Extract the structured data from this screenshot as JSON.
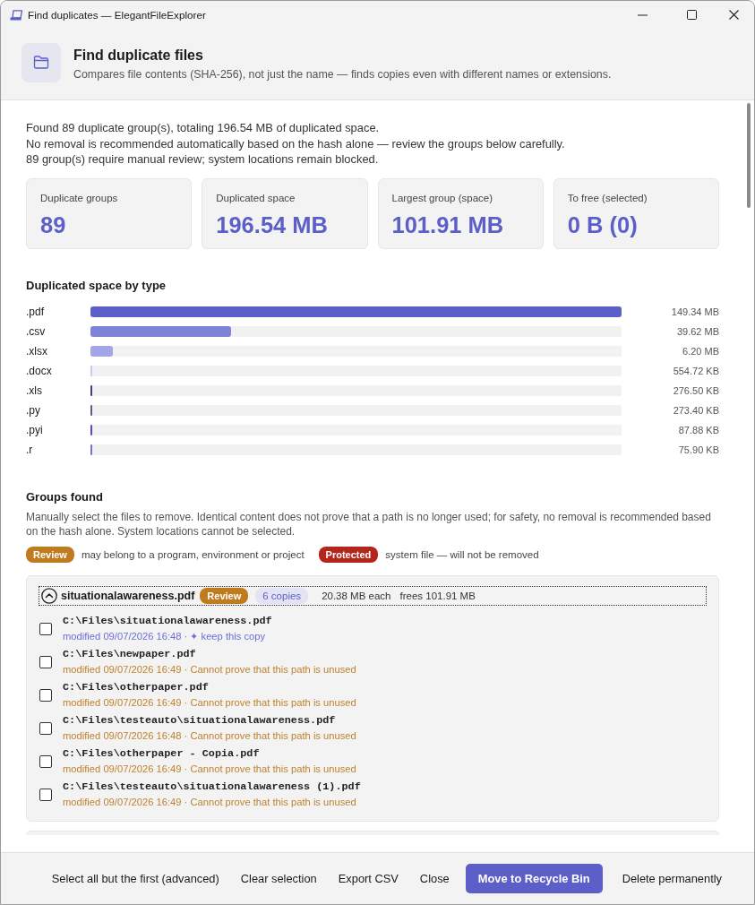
{
  "window": {
    "title": "Find duplicates — ElegantFileExplorer"
  },
  "header": {
    "title": "Find duplicate files",
    "subtitle": "Compares file contents (SHA-256), not just the name — finds copies even with different names or extensions."
  },
  "summary": [
    "Found 89 duplicate group(s), totaling 196.54 MB of duplicated space.",
    "No removal is recommended automatically based on the hash alone — review the groups below carefully.",
    "89 group(s) require manual review; system locations remain blocked."
  ],
  "stats": [
    {
      "label": "Duplicate groups",
      "value": "89"
    },
    {
      "label": "Duplicated space",
      "value": "196.54 MB"
    },
    {
      "label": "Largest group (space)",
      "value": "101.91 MB"
    },
    {
      "label": "To free (selected)",
      "value": "0 B (0)"
    }
  ],
  "by_type": {
    "title": "Duplicated space by type",
    "rows": [
      {
        "label": ".pdf",
        "level": 1,
        "reading": "149.34 MB",
        "color": "#5b5fc7"
      },
      {
        "label": ".csv",
        "level": 0.265,
        "reading": "39.62 MB",
        "color": "#7f83d8"
      },
      {
        "label": ".xlsx",
        "level": 0.042,
        "reading": "6.20 MB",
        "color": "#a3a6e6"
      },
      {
        "label": ".docx",
        "level": 0.004,
        "reading": "554.72 KB",
        "color": "#c8caf0"
      },
      {
        "label": ".xls",
        "level": 0.002,
        "reading": "276.50 KB",
        "color": "#3d4180"
      },
      {
        "label": ".py",
        "level": 0.002,
        "reading": "273.40 KB",
        "color": "#5a5d85"
      },
      {
        "label": ".pyi",
        "level": 0.001,
        "reading": "87.88 KB",
        "color": "#4a4fd0"
      },
      {
        "label": ".r",
        "level": 0.001,
        "reading": "75.90 KB",
        "color": "#6e72e0"
      }
    ]
  },
  "groups_section": {
    "title": "Groups found",
    "description": "Manually select the files to remove. Identical content does not prove that a path is no longer used; for safety, no removal is recommended based on the hash alone. System locations cannot be selected.",
    "legend": [
      {
        "badge": "Review",
        "kind": "review",
        "text": "may belong to a program, environment or project"
      },
      {
        "badge": "Protected",
        "kind": "protected",
        "text": "system file — will not be removed"
      }
    ],
    "groups": [
      {
        "name": "situationalawareness.pdf",
        "expanded": true,
        "badge": {
          "label": "Review",
          "kind": "review"
        },
        "copies": "6 copies",
        "each": "20.38 MB each",
        "frees": "frees 101.91 MB",
        "files": [
          {
            "path": "C:\\Files\\situationalawareness.pdf",
            "meta": "modified 09/07/2026 16:48 · ✦ keep this copy",
            "kind": "keep",
            "checked": false
          },
          {
            "path": "C:\\Files\\newpaper.pdf",
            "meta": "modified 09/07/2026 16:49 · Cannot prove that this path is unused",
            "kind": "warn",
            "checked": false
          },
          {
            "path": "C:\\Files\\otherpaper.pdf",
            "meta": "modified 09/07/2026 16:49 · Cannot prove that this path is unused",
            "kind": "warn",
            "checked": false
          },
          {
            "path": "C:\\Files\\testeauto\\situationalawareness.pdf",
            "meta": "modified 09/07/2026 16:48 · Cannot prove that this path is unused",
            "kind": "warn",
            "checked": false
          },
          {
            "path": "C:\\Files\\otherpaper - Copia.pdf",
            "meta": "modified 09/07/2026 16:49 · Cannot prove that this path is unused",
            "kind": "warn",
            "checked": false
          },
          {
            "path": "C:\\Files\\testeauto\\situationalawareness (1).pdf",
            "meta": "modified 09/07/2026 16:49 · Cannot prove that this path is unused",
            "kind": "warn",
            "checked": false
          }
        ]
      }
    ]
  },
  "buttons": [
    {
      "label": "Select all but the first (advanced)",
      "kind": "text"
    },
    {
      "label": "Clear selection",
      "kind": "text"
    },
    {
      "label": "Export CSV",
      "kind": "text"
    },
    {
      "label": "Close",
      "kind": "text"
    },
    {
      "label": "Move to Recycle Bin",
      "kind": "primary"
    },
    {
      "label": "Delete permanently",
      "kind": "text"
    }
  ]
}
